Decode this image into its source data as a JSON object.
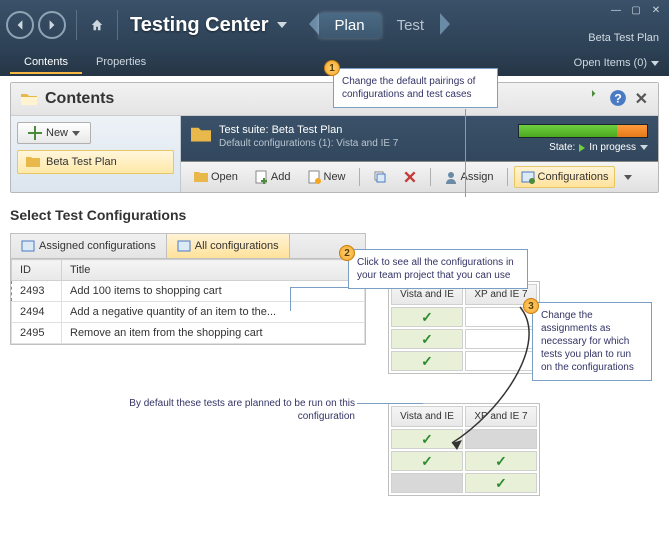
{
  "app": {
    "title": "Testing Center",
    "plan_name": "Beta Test Plan"
  },
  "main_tabs": {
    "plan": "Plan",
    "test": "Test"
  },
  "sub_tabs": {
    "contents": "Contents",
    "properties": "Properties"
  },
  "open_items": {
    "label": "Open Items (0)"
  },
  "contents_panel": {
    "title": "Contents"
  },
  "tree": {
    "new_label": "New",
    "root_item": "Beta Test Plan"
  },
  "suite": {
    "title": "Test suite:  Beta Test Plan",
    "subtitle": "Default configurations (1): Vista and IE 7",
    "state_label": "State:",
    "state_value": "In progess"
  },
  "toolbar": {
    "open": "Open",
    "add": "Add",
    "new": "New",
    "assign": "Assign",
    "configurations": "Configurations"
  },
  "select_cfg": {
    "title": "Select Test Configurations",
    "tab_assigned": "Assigned configurations",
    "tab_all": "All configurations",
    "col_id": "ID",
    "col_title": "Title",
    "rows": [
      {
        "id": "2493",
        "title": "Add 100 items to shopping cart"
      },
      {
        "id": "2494",
        "title": "Add a negative quantity of an item to the..."
      },
      {
        "id": "2495",
        "title": "Remove an item from the shopping cart"
      }
    ]
  },
  "matrix_cols": {
    "c1": "Vista and IE",
    "c2": "XP and IE 7"
  },
  "callouts": {
    "c1": "Change the default pairings of configurations and test cases",
    "c2": "Click to see all the configurations in your team project that you can use",
    "c3": "Change the assignments as necessary for which tests you plan to run on the configurations",
    "note": "By default these tests are planned to be run on this configuration"
  },
  "badges": {
    "b1": "1",
    "b2": "2",
    "b3": "3"
  }
}
